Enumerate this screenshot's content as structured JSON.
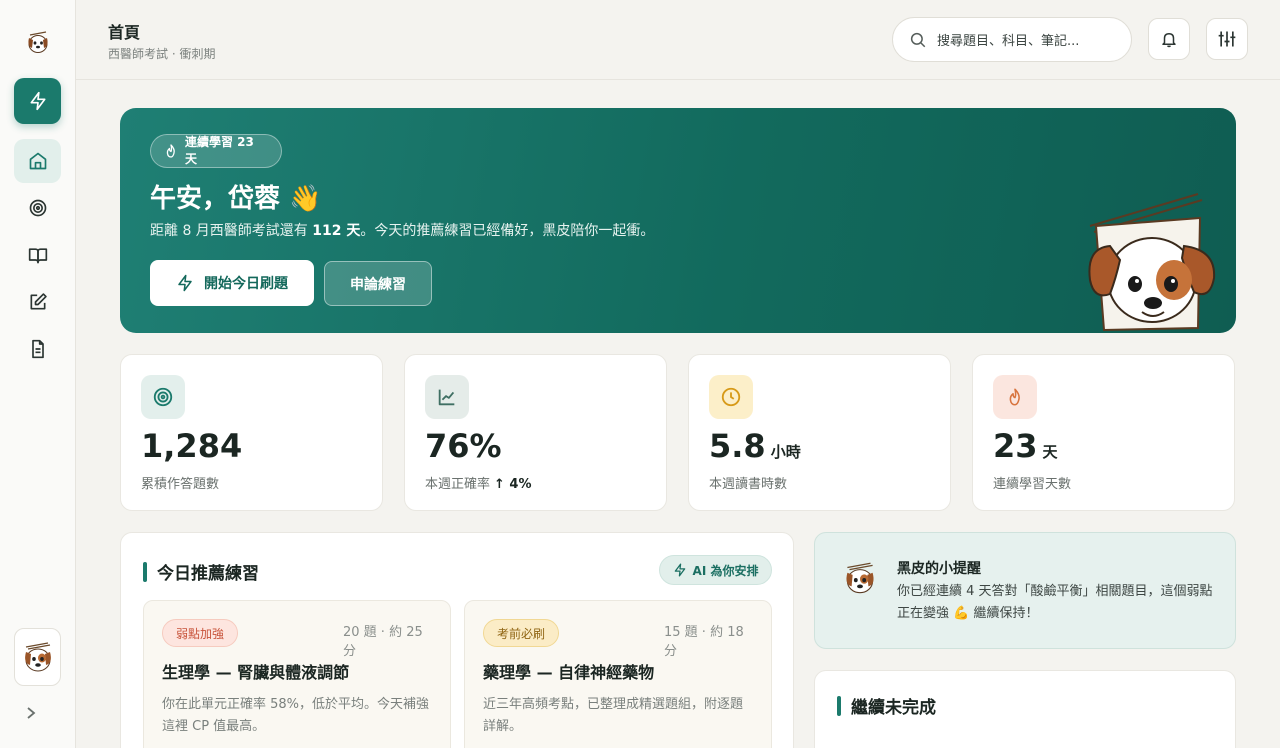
{
  "header": {
    "title": "首頁",
    "subtitle": "西醫師考試 · 衝刺期",
    "search_placeholder": "搜尋題目、科目、筆記..."
  },
  "hero": {
    "streak_label": "連續學習 23 天",
    "greeting": "午安，岱蓉 👋",
    "desc_prefix": "距離 8 月西醫師考試還有 ",
    "desc_days": "112 天",
    "desc_suffix": "。今天的推薦練習已經備好，黑皮陪你一起衝。",
    "primary_button": "開始今日刷題",
    "secondary_button": "申論練習"
  },
  "stats": [
    {
      "value": "1,284",
      "unit": "",
      "label": "累積作答題數",
      "extra": "",
      "icon": "target-icon"
    },
    {
      "value": "76%",
      "unit": "",
      "label": "本週正確率",
      "extra": "↑ 4%",
      "icon": "trend-chart-icon"
    },
    {
      "value": "5.8",
      "unit": "小時",
      "label": "本週讀書時數",
      "extra": "",
      "icon": "clock-icon"
    },
    {
      "value": "23",
      "unit": "天",
      "label": "連續學習天數",
      "extra": "",
      "icon": "flame-icon"
    }
  ],
  "recommend": {
    "title": "今日推薦練習",
    "ai_label": "AI 為你安排",
    "cards": [
      {
        "tag": "弱點加強",
        "meta": "20 題 · 約 25 分",
        "title": "生理學 — 腎臟與體液調節",
        "desc": "你在此單元正確率 58%，低於平均。今天補強這裡 CP 值最高。"
      },
      {
        "tag": "考前必刷",
        "meta": "15 題 · 約 18 分",
        "title": "藥理學 — 自律神經藥物",
        "desc": "近三年高頻考點，已整理成精選題組，附逐題詳解。"
      }
    ]
  },
  "tip": {
    "title": "黑皮的小提醒",
    "text": "你已經連續 4 天答對「酸鹼平衡」相關題目，這個弱點正在變強 💪 繼續保持！"
  },
  "continue": {
    "title": "繼續未完成"
  },
  "colors": {
    "brand": "#1b7a6c",
    "hero_gradient_start": "#1f7f74",
    "hero_gradient_end": "#0f5d52",
    "weak_tag_bg": "#fde5df",
    "must_tag_bg": "#fbecc6"
  }
}
